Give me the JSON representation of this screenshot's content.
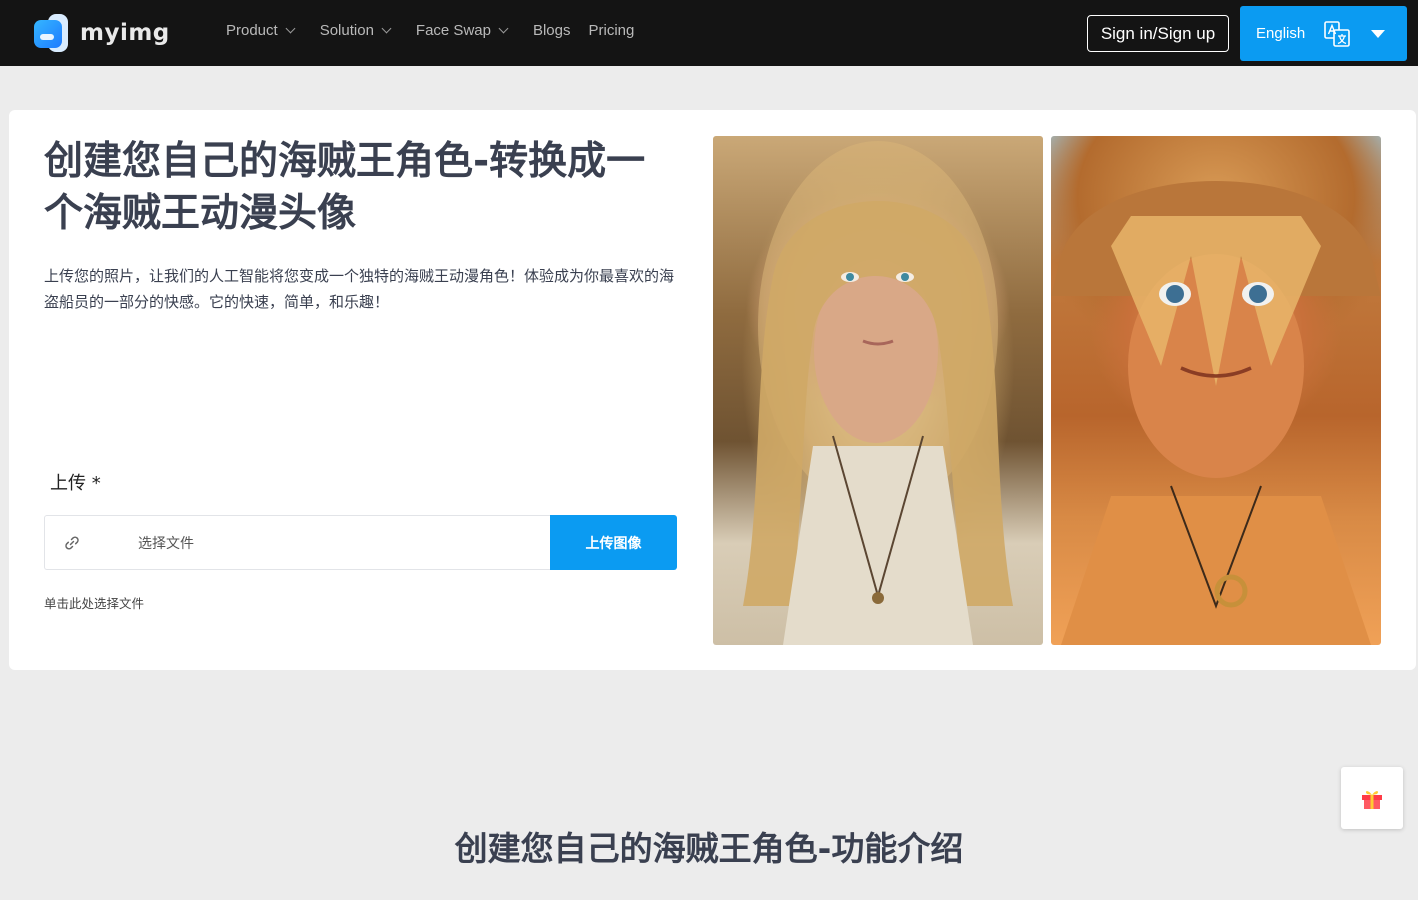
{
  "header": {
    "brand": "myimg",
    "nav": [
      {
        "label": "Product",
        "has_dropdown": true
      },
      {
        "label": "Solution",
        "has_dropdown": true
      },
      {
        "label": "Face Swap",
        "has_dropdown": true
      },
      {
        "label": "Blogs",
        "has_dropdown": false
      },
      {
        "label": "Pricing",
        "has_dropdown": false
      }
    ],
    "signin_label": "Sign in/Sign up",
    "language": {
      "label": "English",
      "icon": "translate-icon"
    }
  },
  "hero": {
    "title": "创建您自己的海贼王角色-转换成一个海贼王动漫头像",
    "description": "上传您的照片，让我们的人工智能将您变成一个独特的海贼王动漫角色！体验成为你最喜欢的海盗船员的一部分的快感。它的快速，简单，和乐趣！",
    "upload": {
      "label": "上传 *",
      "placeholder": "选择文件",
      "button": "上传图像",
      "hint": "单击此处选择文件",
      "icon": "link-icon"
    },
    "images": [
      {
        "name": "original-photo"
      },
      {
        "name": "anime-result-photo"
      }
    ]
  },
  "features": {
    "title": "创建您自己的海贼王角色-功能介绍"
  },
  "floating": {
    "icon": "gift-icon"
  },
  "colors": {
    "topbar": "#141414",
    "accent": "#0b9bf2",
    "page_bg": "#ececec",
    "heading": "#3a4050"
  }
}
